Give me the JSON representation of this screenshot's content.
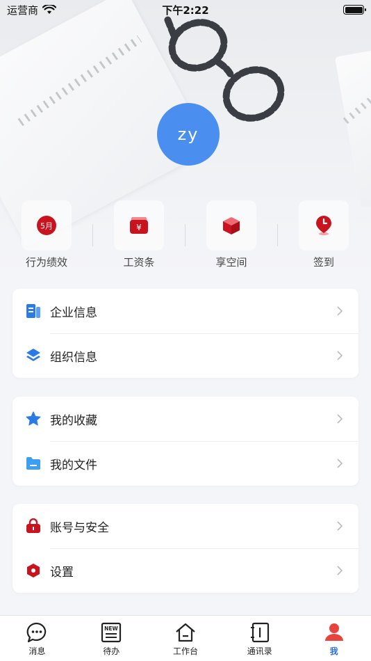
{
  "status_bar": {
    "carrier": "运营商",
    "time": "下午2:22"
  },
  "profile": {
    "avatar_text": "zy",
    "avatar_color": "#4a8ff0"
  },
  "quick_actions": [
    {
      "label": "行为绩效",
      "icon": "calendar-badge-icon",
      "badge": "5月"
    },
    {
      "label": "工资条",
      "icon": "wallet-icon"
    },
    {
      "label": "享空间",
      "icon": "cube-icon"
    },
    {
      "label": "签到",
      "icon": "location-clock-icon"
    }
  ],
  "groups": [
    {
      "items": [
        {
          "label": "企业信息",
          "icon": "document-icon"
        },
        {
          "label": "组织信息",
          "icon": "layers-icon"
        }
      ]
    },
    {
      "items": [
        {
          "label": "我的收藏",
          "icon": "star-icon"
        },
        {
          "label": "我的文件",
          "icon": "folder-icon"
        }
      ]
    },
    {
      "items": [
        {
          "label": "账号与安全",
          "icon": "lock-bag-icon"
        },
        {
          "label": "设置",
          "icon": "hexagon-settings-icon"
        }
      ]
    }
  ],
  "tab_bar": {
    "active": "我",
    "tabs": [
      {
        "label": "消息",
        "icon": "chat-bubble-icon"
      },
      {
        "label": "待办",
        "icon": "new-list-icon",
        "icon_text": "NEW"
      },
      {
        "label": "工作台",
        "icon": "home-icon"
      },
      {
        "label": "通讯录",
        "icon": "contacts-book-icon"
      },
      {
        "label": "我",
        "icon": "person-icon"
      }
    ]
  },
  "colors": {
    "accent": "#2f6fe0",
    "red": "#d7202c",
    "blue_icon": "#2b7be6"
  }
}
